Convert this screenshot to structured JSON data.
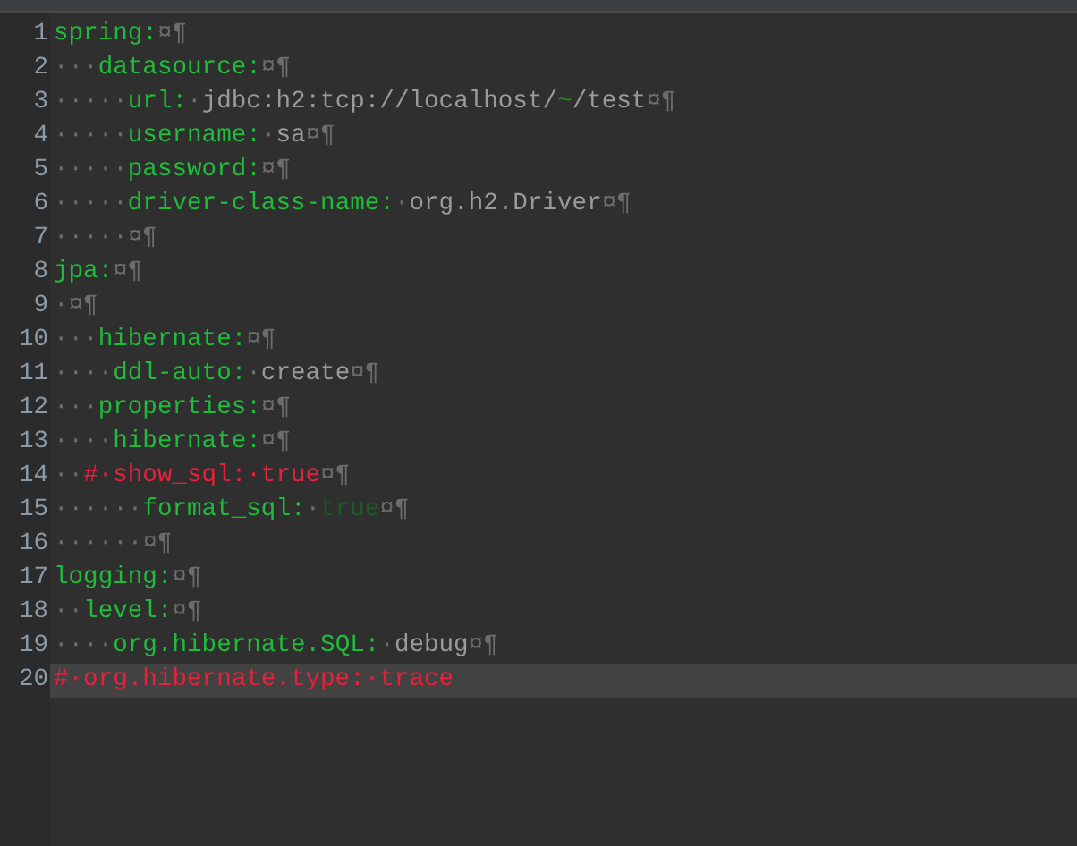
{
  "editor": {
    "lines": [
      {
        "number": "1",
        "current": false,
        "tokens": [
          {
            "kind": "key",
            "text": "spring:"
          },
          {
            "kind": "eol",
            "text": "¤¶"
          }
        ]
      },
      {
        "number": "2",
        "current": false,
        "tokens": [
          {
            "kind": "space",
            "text": "···"
          },
          {
            "kind": "key",
            "text": "datasource:"
          },
          {
            "kind": "eol",
            "text": "¤¶"
          }
        ]
      },
      {
        "number": "3",
        "current": false,
        "tokens": [
          {
            "kind": "space",
            "text": "·····"
          },
          {
            "kind": "key",
            "text": "url:"
          },
          {
            "kind": "space",
            "text": "·"
          },
          {
            "kind": "value",
            "text": "jdbc:h2:tcp://localhost/"
          },
          {
            "kind": "special",
            "text": "~"
          },
          {
            "kind": "value",
            "text": "/test"
          },
          {
            "kind": "eol",
            "text": "¤¶"
          }
        ]
      },
      {
        "number": "4",
        "current": false,
        "tokens": [
          {
            "kind": "space",
            "text": "·····"
          },
          {
            "kind": "key",
            "text": "username:"
          },
          {
            "kind": "space",
            "text": "·"
          },
          {
            "kind": "value",
            "text": "sa"
          },
          {
            "kind": "eol",
            "text": "¤¶"
          }
        ]
      },
      {
        "number": "5",
        "current": false,
        "tokens": [
          {
            "kind": "space",
            "text": "·····"
          },
          {
            "kind": "key",
            "text": "password:"
          },
          {
            "kind": "eol",
            "text": "¤¶"
          }
        ]
      },
      {
        "number": "6",
        "current": false,
        "tokens": [
          {
            "kind": "space",
            "text": "·····"
          },
          {
            "kind": "key",
            "text": "driver-class-name:"
          },
          {
            "kind": "space",
            "text": "·"
          },
          {
            "kind": "value",
            "text": "org.h2.Driver"
          },
          {
            "kind": "eol",
            "text": "¤¶"
          }
        ]
      },
      {
        "number": "7",
        "current": false,
        "tokens": [
          {
            "kind": "space",
            "text": "·····"
          },
          {
            "kind": "eol",
            "text": "¤¶"
          }
        ]
      },
      {
        "number": "8",
        "current": false,
        "tokens": [
          {
            "kind": "key",
            "text": "jpa:"
          },
          {
            "kind": "eol",
            "text": "¤¶"
          }
        ]
      },
      {
        "number": "9",
        "current": false,
        "tokens": [
          {
            "kind": "space",
            "text": "·"
          },
          {
            "kind": "eol",
            "text": "¤¶"
          }
        ]
      },
      {
        "number": "10",
        "current": false,
        "tokens": [
          {
            "kind": "space",
            "text": "···"
          },
          {
            "kind": "key",
            "text": "hibernate:"
          },
          {
            "kind": "eol",
            "text": "¤¶"
          }
        ]
      },
      {
        "number": "11",
        "current": false,
        "tokens": [
          {
            "kind": "space",
            "text": "····"
          },
          {
            "kind": "key",
            "text": "ddl-auto:"
          },
          {
            "kind": "space",
            "text": "·"
          },
          {
            "kind": "value",
            "text": "create"
          },
          {
            "kind": "eol",
            "text": "¤¶"
          }
        ]
      },
      {
        "number": "12",
        "current": false,
        "tokens": [
          {
            "kind": "space",
            "text": "···"
          },
          {
            "kind": "key",
            "text": "properties:"
          },
          {
            "kind": "eol",
            "text": "¤¶"
          }
        ]
      },
      {
        "number": "13",
        "current": false,
        "tokens": [
          {
            "kind": "space",
            "text": "····"
          },
          {
            "kind": "key",
            "text": "hibernate:"
          },
          {
            "kind": "eol",
            "text": "¤¶"
          }
        ]
      },
      {
        "number": "14",
        "current": false,
        "tokens": [
          {
            "kind": "space",
            "text": "··"
          },
          {
            "kind": "comment",
            "text": "#·show_sql:·true"
          },
          {
            "kind": "eol",
            "text": "¤¶"
          }
        ]
      },
      {
        "number": "15",
        "current": false,
        "tokens": [
          {
            "kind": "space",
            "text": "······"
          },
          {
            "kind": "key",
            "text": "format_sql:"
          },
          {
            "kind": "space",
            "text": "·"
          },
          {
            "kind": "boolean",
            "text": "true"
          },
          {
            "kind": "eol",
            "text": "¤¶"
          }
        ]
      },
      {
        "number": "16",
        "current": false,
        "tokens": [
          {
            "kind": "space",
            "text": "······"
          },
          {
            "kind": "eol",
            "text": "¤¶"
          }
        ]
      },
      {
        "number": "17",
        "current": false,
        "tokens": [
          {
            "kind": "key",
            "text": "logging:"
          },
          {
            "kind": "eol",
            "text": "¤¶"
          }
        ]
      },
      {
        "number": "18",
        "current": false,
        "tokens": [
          {
            "kind": "space",
            "text": "··"
          },
          {
            "kind": "key",
            "text": "level:"
          },
          {
            "kind": "eol",
            "text": "¤¶"
          }
        ]
      },
      {
        "number": "19",
        "current": false,
        "tokens": [
          {
            "kind": "space",
            "text": "····"
          },
          {
            "kind": "key",
            "text": "org.hibernate.SQL:"
          },
          {
            "kind": "space",
            "text": "·"
          },
          {
            "kind": "value",
            "text": "debug"
          },
          {
            "kind": "eol",
            "text": "¤¶"
          }
        ]
      },
      {
        "number": "20",
        "current": true,
        "tokens": [
          {
            "kind": "comment",
            "text": "#·org.hibernate.type:·trace"
          }
        ]
      }
    ]
  }
}
